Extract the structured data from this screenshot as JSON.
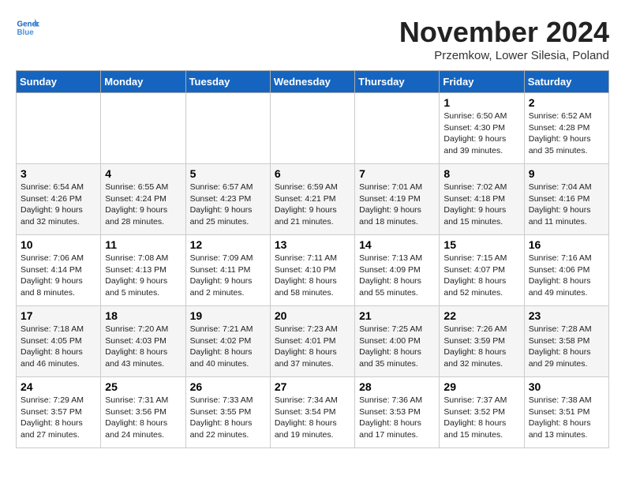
{
  "header": {
    "logo_line1": "General",
    "logo_line2": "Blue",
    "month": "November 2024",
    "location": "Przemkow, Lower Silesia, Poland"
  },
  "weekdays": [
    "Sunday",
    "Monday",
    "Tuesday",
    "Wednesday",
    "Thursday",
    "Friday",
    "Saturday"
  ],
  "weeks": [
    [
      {
        "num": "",
        "info": ""
      },
      {
        "num": "",
        "info": ""
      },
      {
        "num": "",
        "info": ""
      },
      {
        "num": "",
        "info": ""
      },
      {
        "num": "",
        "info": ""
      },
      {
        "num": "1",
        "info": "Sunrise: 6:50 AM\nSunset: 4:30 PM\nDaylight: 9 hours\nand 39 minutes."
      },
      {
        "num": "2",
        "info": "Sunrise: 6:52 AM\nSunset: 4:28 PM\nDaylight: 9 hours\nand 35 minutes."
      }
    ],
    [
      {
        "num": "3",
        "info": "Sunrise: 6:54 AM\nSunset: 4:26 PM\nDaylight: 9 hours\nand 32 minutes."
      },
      {
        "num": "4",
        "info": "Sunrise: 6:55 AM\nSunset: 4:24 PM\nDaylight: 9 hours\nand 28 minutes."
      },
      {
        "num": "5",
        "info": "Sunrise: 6:57 AM\nSunset: 4:23 PM\nDaylight: 9 hours\nand 25 minutes."
      },
      {
        "num": "6",
        "info": "Sunrise: 6:59 AM\nSunset: 4:21 PM\nDaylight: 9 hours\nand 21 minutes."
      },
      {
        "num": "7",
        "info": "Sunrise: 7:01 AM\nSunset: 4:19 PM\nDaylight: 9 hours\nand 18 minutes."
      },
      {
        "num": "8",
        "info": "Sunrise: 7:02 AM\nSunset: 4:18 PM\nDaylight: 9 hours\nand 15 minutes."
      },
      {
        "num": "9",
        "info": "Sunrise: 7:04 AM\nSunset: 4:16 PM\nDaylight: 9 hours\nand 11 minutes."
      }
    ],
    [
      {
        "num": "10",
        "info": "Sunrise: 7:06 AM\nSunset: 4:14 PM\nDaylight: 9 hours\nand 8 minutes."
      },
      {
        "num": "11",
        "info": "Sunrise: 7:08 AM\nSunset: 4:13 PM\nDaylight: 9 hours\nand 5 minutes."
      },
      {
        "num": "12",
        "info": "Sunrise: 7:09 AM\nSunset: 4:11 PM\nDaylight: 9 hours\nand 2 minutes."
      },
      {
        "num": "13",
        "info": "Sunrise: 7:11 AM\nSunset: 4:10 PM\nDaylight: 8 hours\nand 58 minutes."
      },
      {
        "num": "14",
        "info": "Sunrise: 7:13 AM\nSunset: 4:09 PM\nDaylight: 8 hours\nand 55 minutes."
      },
      {
        "num": "15",
        "info": "Sunrise: 7:15 AM\nSunset: 4:07 PM\nDaylight: 8 hours\nand 52 minutes."
      },
      {
        "num": "16",
        "info": "Sunrise: 7:16 AM\nSunset: 4:06 PM\nDaylight: 8 hours\nand 49 minutes."
      }
    ],
    [
      {
        "num": "17",
        "info": "Sunrise: 7:18 AM\nSunset: 4:05 PM\nDaylight: 8 hours\nand 46 minutes."
      },
      {
        "num": "18",
        "info": "Sunrise: 7:20 AM\nSunset: 4:03 PM\nDaylight: 8 hours\nand 43 minutes."
      },
      {
        "num": "19",
        "info": "Sunrise: 7:21 AM\nSunset: 4:02 PM\nDaylight: 8 hours\nand 40 minutes."
      },
      {
        "num": "20",
        "info": "Sunrise: 7:23 AM\nSunset: 4:01 PM\nDaylight: 8 hours\nand 37 minutes."
      },
      {
        "num": "21",
        "info": "Sunrise: 7:25 AM\nSunset: 4:00 PM\nDaylight: 8 hours\nand 35 minutes."
      },
      {
        "num": "22",
        "info": "Sunrise: 7:26 AM\nSunset: 3:59 PM\nDaylight: 8 hours\nand 32 minutes."
      },
      {
        "num": "23",
        "info": "Sunrise: 7:28 AM\nSunset: 3:58 PM\nDaylight: 8 hours\nand 29 minutes."
      }
    ],
    [
      {
        "num": "24",
        "info": "Sunrise: 7:29 AM\nSunset: 3:57 PM\nDaylight: 8 hours\nand 27 minutes."
      },
      {
        "num": "25",
        "info": "Sunrise: 7:31 AM\nSunset: 3:56 PM\nDaylight: 8 hours\nand 24 minutes."
      },
      {
        "num": "26",
        "info": "Sunrise: 7:33 AM\nSunset: 3:55 PM\nDaylight: 8 hours\nand 22 minutes."
      },
      {
        "num": "27",
        "info": "Sunrise: 7:34 AM\nSunset: 3:54 PM\nDaylight: 8 hours\nand 19 minutes."
      },
      {
        "num": "28",
        "info": "Sunrise: 7:36 AM\nSunset: 3:53 PM\nDaylight: 8 hours\nand 17 minutes."
      },
      {
        "num": "29",
        "info": "Sunrise: 7:37 AM\nSunset: 3:52 PM\nDaylight: 8 hours\nand 15 minutes."
      },
      {
        "num": "30",
        "info": "Sunrise: 7:38 AM\nSunset: 3:51 PM\nDaylight: 8 hours\nand 13 minutes."
      }
    ]
  ]
}
